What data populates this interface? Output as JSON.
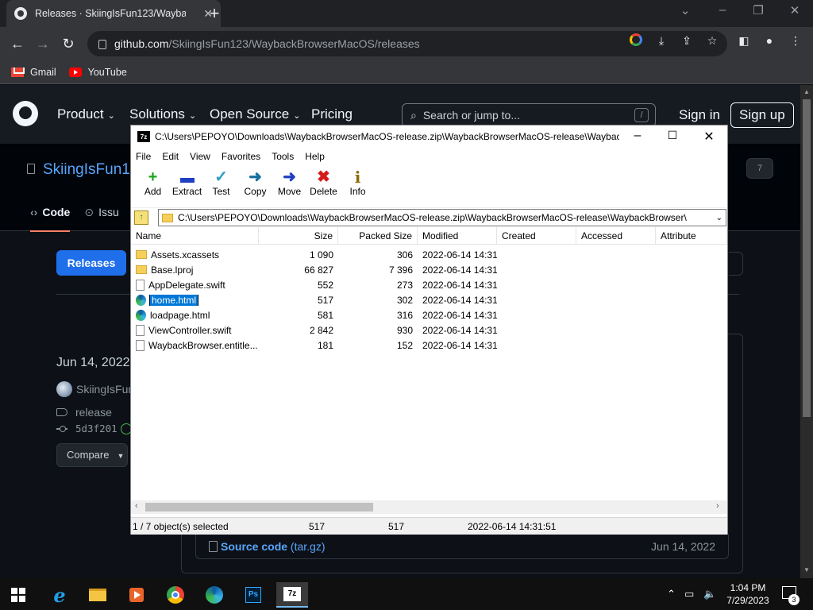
{
  "browser": {
    "tab_title": "Releases · SkiingIsFun123/Wayba",
    "url_host": "github.com",
    "url_path": "/SkiingIsFun123/WaybackBrowserMacOS/releases",
    "bookmarks": [
      {
        "label": "Gmail",
        "icon": "gmail-icon"
      },
      {
        "label": "YouTube",
        "icon": "youtube-icon"
      }
    ]
  },
  "github": {
    "nav": [
      "Product",
      "Solutions",
      "Open Source",
      "Pricing"
    ],
    "search_placeholder": "Search or jump to...",
    "search_shortcut": "/",
    "sign_in": "Sign in",
    "sign_up": "Sign up",
    "repo_owner_partial": "SkiingIsFun1",
    "repo_badge": "7",
    "tabs": {
      "code": "Code",
      "issues": "Issu"
    },
    "releases_button": "Releases",
    "release": {
      "date": "Jun 14, 2022",
      "author": "SkiingIsFun",
      "tag": "release",
      "commit": "5d3f201",
      "compare": "Compare"
    },
    "asset": {
      "name": "Source code",
      "ext": "(tar.gz)",
      "date": "Jun 14, 2022"
    }
  },
  "sevenzip": {
    "title": "C:\\Users\\PEPOYO\\Downloads\\WaybackBrowserMacOS-release.zip\\WaybackBrowserMacOS-release\\Waybac...",
    "app_icon_text": "7z",
    "menu": [
      "File",
      "Edit",
      "View",
      "Favorites",
      "Tools",
      "Help"
    ],
    "toolbar": [
      {
        "label": "Add",
        "icon": "add-icon"
      },
      {
        "label": "Extract",
        "icon": "extract-icon"
      },
      {
        "label": "Test",
        "icon": "test-icon"
      },
      {
        "label": "Copy",
        "icon": "copy-icon"
      },
      {
        "label": "Move",
        "icon": "move-icon"
      },
      {
        "label": "Delete",
        "icon": "delete-icon"
      },
      {
        "label": "Info",
        "icon": "info-icon"
      }
    ],
    "path": "C:\\Users\\PEPOYO\\Downloads\\WaybackBrowserMacOS-release.zip\\WaybackBrowserMacOS-release\\WaybackBrowser\\",
    "columns": [
      "Name",
      "Size",
      "Packed Size",
      "Modified",
      "Created",
      "Accessed",
      "Attribute"
    ],
    "files": [
      {
        "name": "Assets.xcassets",
        "size": "1 090",
        "packed": "306",
        "modified": "2022-06-14 14:31",
        "type": "folder"
      },
      {
        "name": "Base.lproj",
        "size": "66 827",
        "packed": "7 396",
        "modified": "2022-06-14 14:31",
        "type": "folder"
      },
      {
        "name": "AppDelegate.swift",
        "size": "552",
        "packed": "273",
        "modified": "2022-06-14 14:31",
        "type": "file"
      },
      {
        "name": "home.html",
        "size": "517",
        "packed": "302",
        "modified": "2022-06-14 14:31",
        "type": "edge",
        "selected": true
      },
      {
        "name": "loadpage.html",
        "size": "581",
        "packed": "316",
        "modified": "2022-06-14 14:31",
        "type": "edge"
      },
      {
        "name": "ViewController.swift",
        "size": "2 842",
        "packed": "930",
        "modified": "2022-06-14 14:31",
        "type": "file"
      },
      {
        "name": "WaybackBrowser.entitle...",
        "size": "181",
        "packed": "152",
        "modified": "2022-06-14 14:31",
        "type": "file"
      }
    ],
    "status": {
      "selection": "1 / 7 object(s) selected",
      "size": "517",
      "packed": "517",
      "modified": "2022-06-14 14:31:51"
    }
  },
  "taskbar": {
    "apps": [
      "internet-explorer-icon",
      "file-explorer-icon",
      "media-player-icon",
      "chrome-icon",
      "edge-icon",
      "photoshop-icon",
      "sevenzip-icon"
    ],
    "ps_label": "Ps",
    "sz_label": "7z",
    "time": "1:04 PM",
    "date": "7/29/2023",
    "notification_count": "3"
  }
}
